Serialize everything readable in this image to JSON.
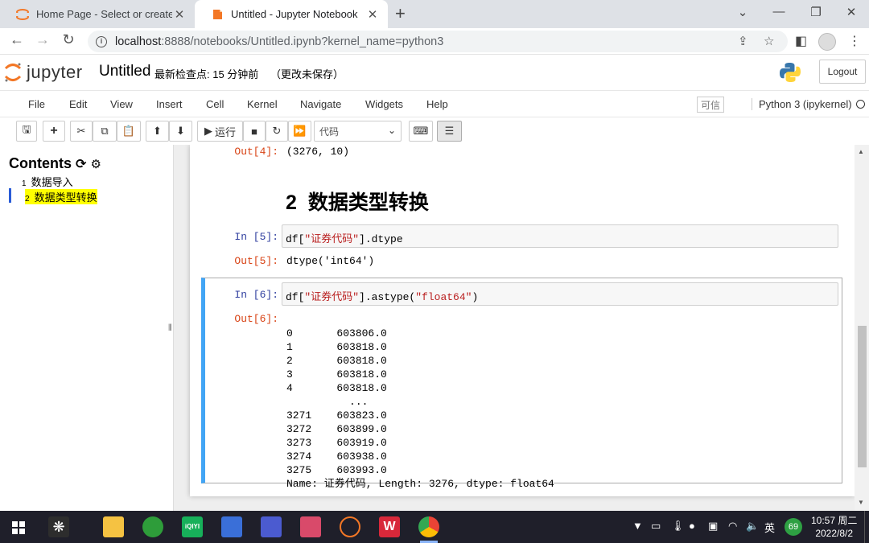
{
  "browser": {
    "tabs": [
      {
        "title": "Home Page - Select or create a notebook",
        "active": false
      },
      {
        "title": "Untitled - Jupyter Notebook",
        "active": true
      }
    ],
    "url": "localhost:8888/notebooks/Untitled.ipynb?kernel_name=python3",
    "url_host": "localhost",
    "url_rest": ":8888/notebooks/Untitled.ipynb?kernel_name=python3"
  },
  "jupyter": {
    "logo_text": "jupyter",
    "notebook_name": "Untitled",
    "checkpoint": "最新检查点: 15 分钟前",
    "save_status": "（更改未保存）",
    "logout_label": "Logout",
    "menu": [
      "File",
      "Edit",
      "View",
      "Insert",
      "Cell",
      "Kernel",
      "Navigate",
      "Widgets",
      "Help"
    ],
    "trusted_label": "可信",
    "kernel_label": "Python 3 (ipykernel)",
    "toolbar": {
      "run_label": "运行",
      "cell_type": "代码"
    }
  },
  "toc": {
    "title": "Contents",
    "items": [
      {
        "num": "1",
        "label": "数据导入",
        "selected": false
      },
      {
        "num": "2",
        "label": "数据类型转换",
        "selected": true
      }
    ]
  },
  "notebook": {
    "out4_prompt": "Out[4]:",
    "out4_text": "(3276, 10)",
    "heading_num": "2",
    "heading_text": "数据类型转换",
    "in5_prompt": "In  [5]:",
    "in5_code_pre": "df[",
    "in5_code_str": "\"证券代码\"",
    "in5_code_post": "].dtype",
    "out5_prompt": "Out[5]:",
    "out5_text": "dtype('int64')",
    "in6_prompt": "In  [6]:",
    "in6_code_pre": "df[",
    "in6_code_str": "\"证券代码\"",
    "in6_code_mid": "].astype(",
    "in6_code_str2": "\"float64\"",
    "in6_code_post": ")",
    "out6_prompt": "Out[6]:",
    "out6_lines": [
      "0       603806.0",
      "1       603818.0",
      "2       603818.0",
      "3       603818.0",
      "4       603818.0",
      "          ...   ",
      "3271    603823.0",
      "3272    603899.0",
      "3273    603919.0",
      "3274    603938.0",
      "3275    603993.0",
      "Name: 证券代码, Length: 3276, dtype: float64"
    ]
  },
  "taskbar": {
    "ime_label": "英",
    "badge_count": "69",
    "time": "10:57 周二",
    "date": "2022/8/2"
  },
  "colors": {
    "prompt_in": "#303f9f",
    "prompt_out": "#d84315",
    "selected_cell_border": "#42a5f5",
    "toc_highlight": "#ffff00",
    "jupyter_orange": "#f37726"
  }
}
